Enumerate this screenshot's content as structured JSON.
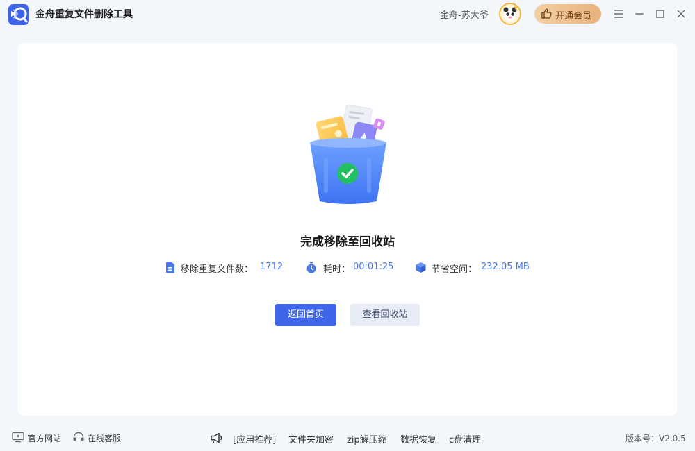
{
  "app": {
    "title": "金舟重复文件删除工具",
    "user_name": "金舟-苏大爷",
    "vip_label": "开通会员"
  },
  "result": {
    "title": "完成移除至回收站",
    "stats": [
      {
        "label": "移除重复文件数：",
        "value": "1712",
        "icon": "document-icon"
      },
      {
        "label": "耗时：",
        "value": "00:01:25",
        "icon": "stopwatch-icon"
      },
      {
        "label": "节省空间：",
        "value": "232.05 MB",
        "icon": "cube-icon"
      }
    ],
    "home_button": "返回首页",
    "recycle_button": "查看回收站"
  },
  "footer": {
    "official_site": "官方网站",
    "online_service": "在线客服",
    "promo_label": "[应用推荐]",
    "promo_links": [
      "文件夹加密",
      "zip解压缩",
      "数据恢复",
      "c盘清理"
    ],
    "version": "版本号：V2.0.5"
  },
  "colors": {
    "accent": "#3f66ea",
    "stat_value": "#4a78e6",
    "success": "#22c063",
    "vip_gradient_start": "#f3d0a4",
    "vip_gradient_end": "#e7b27c"
  }
}
